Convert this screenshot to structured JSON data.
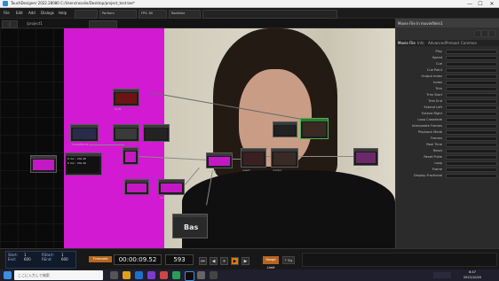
{
  "window": {
    "title": "TouchDesigner 2022.28080 C:/Users/rosalie/Desktop/project_test.toe*",
    "minimize": "—",
    "maximize": "☐",
    "close": "✕"
  },
  "menu": [
    "File",
    "Edit",
    "Add",
    "Dialogs",
    "Help"
  ],
  "toolbar": {
    "fps_label": "FPS: 60",
    "realtime_label": "Realtime",
    "perform_label": "Perform",
    "path_text": "/project1"
  },
  "network": {
    "nodes": [
      {
        "id": "moviefilein1",
        "label": "moviefilein1"
      },
      {
        "id": "null1",
        "label": "null1"
      },
      {
        "id": "text1",
        "label": "text1"
      },
      {
        "id": "level1",
        "label": "level1"
      },
      {
        "id": "over1",
        "label": "over1"
      },
      {
        "id": "comp1",
        "label": "comp1"
      },
      {
        "id": "out1",
        "label": "out1"
      },
      {
        "id": "base1",
        "label": "Bas"
      }
    ],
    "info_lines": [
      "0  dur : 20s 40",
      "0  dur : 20s 40"
    ]
  },
  "params": {
    "title": "Movie File In   moviefilein1",
    "tabs": [
      "Movie File",
      "Info",
      "Advanced",
      "Preload",
      "Common"
    ],
    "rows": [
      {
        "label": "Play"
      },
      {
        "label": "Speed"
      },
      {
        "label": "Cue"
      },
      {
        "label": "Cue Point"
      },
      {
        "label": "Output Index"
      },
      {
        "label": "Index"
      },
      {
        "label": "Trim"
      },
      {
        "label": "Trim Start"
      },
      {
        "label": "Trim End"
      },
      {
        "label": "Extend Left"
      },
      {
        "label": "Extend Right"
      },
      {
        "label": "Loop Crossfade"
      },
      {
        "label": "Interpolate Frames"
      },
      {
        "label": "Playback Mode"
      },
      {
        "label": "Frames"
      },
      {
        "label": "Real Time"
      },
      {
        "label": "Reset"
      },
      {
        "label": "Reset Pulse"
      },
      {
        "label": "Loop"
      },
      {
        "label": "Frame"
      },
      {
        "label": "Display Fractional"
      }
    ]
  },
  "timeline": {
    "left_stats": [
      "Start:",
      "End:",
      "RStart:",
      "REnd:"
    ],
    "left_values": [
      "1",
      "600",
      "1",
      "600"
    ],
    "mode_label": "Timecode",
    "time": "00:00:09.52",
    "frame": "593",
    "range_label": "Range Limit",
    "tempo_label": "T Sig"
  },
  "taskbar": {
    "search_placeholder": "ここに入力して検索",
    "time": "8:47",
    "date": "2022/10/20"
  },
  "colors": {
    "accent": "#d11ad1",
    "active": "#e47a00"
  }
}
